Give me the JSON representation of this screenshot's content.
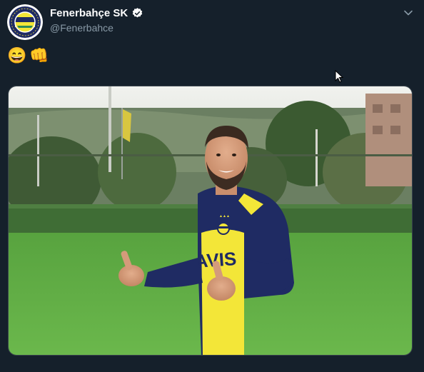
{
  "tweet": {
    "author": {
      "display_name": "Fenerbahçe SK",
      "handle": "@Fenerbahce",
      "verified": true,
      "avatar_icon": "fenerbahce-crest-icon"
    },
    "text": {
      "emojis": [
        "😄",
        "👊"
      ]
    },
    "media": {
      "type": "photo",
      "jersey_text": "AVIS"
    },
    "menu_icon": "chevron-down-icon"
  },
  "colors": {
    "background": "#15202b",
    "name": "#ffffff",
    "handle": "#8899a6",
    "verified": "#ffffff",
    "fb_navy": "#1f2b63",
    "fb_yellow": "#f3e638"
  }
}
